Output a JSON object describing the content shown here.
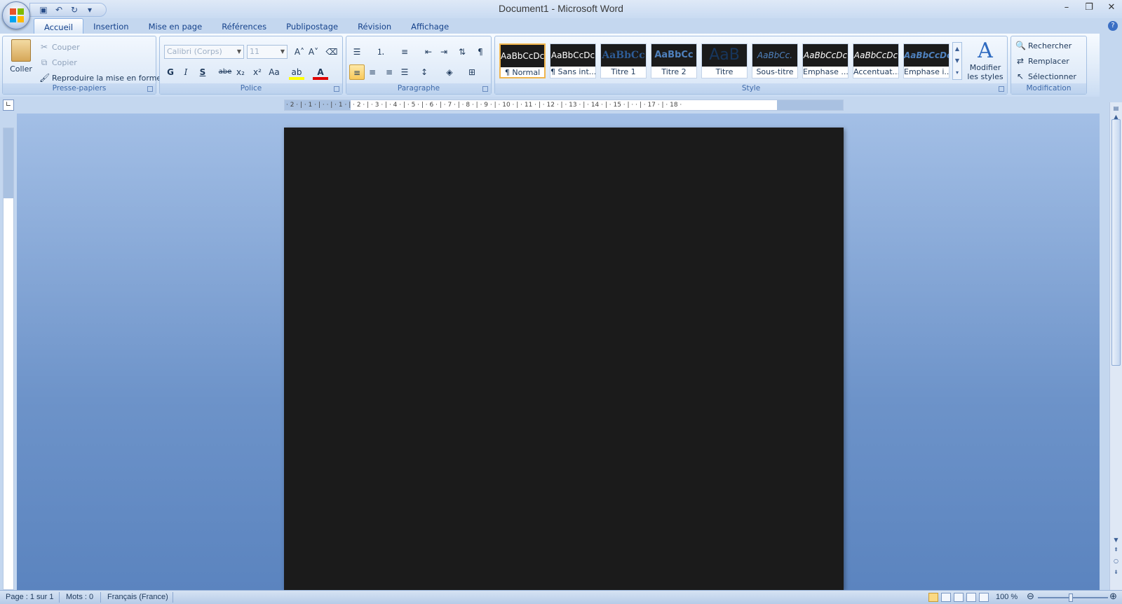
{
  "window": {
    "title": "Document1 - Microsoft Word"
  },
  "qat": {
    "save": "save-icon",
    "undo": "undo-icon",
    "redo": "redo-icon",
    "customize": "▾"
  },
  "tabs": [
    {
      "label": "Accueil"
    },
    {
      "label": "Insertion"
    },
    {
      "label": "Mise en page"
    },
    {
      "label": "Références"
    },
    {
      "label": "Publipostage"
    },
    {
      "label": "Révision"
    },
    {
      "label": "Affichage"
    }
  ],
  "clipboard": {
    "paste": "Coller",
    "cut": "Couper",
    "copy": "Copier",
    "format_painter": "Reproduire la mise en forme",
    "label": "Presse-papiers"
  },
  "font": {
    "name": "Calibri (Corps)",
    "size": "11",
    "label": "Police",
    "bold": "G",
    "italic": "I",
    "underline": "S",
    "strike": "abe",
    "subscript": "x₂",
    "superscript": "x²",
    "case": "Aa",
    "grow": "A˄",
    "shrink": "A˅"
  },
  "paragraph": {
    "label": "Paragraphe",
    "pilcrow": "¶"
  },
  "styles": {
    "label": "Style",
    "items": [
      {
        "preview": "AaBbCcDc",
        "name": "¶ Normal"
      },
      {
        "preview": "AaBbCcDc",
        "name": "¶ Sans int..."
      },
      {
        "preview": "AaBbCc",
        "name": "Titre 1"
      },
      {
        "preview": "AaBbCc",
        "name": "Titre 2"
      },
      {
        "preview": "AaB",
        "name": "Titre"
      },
      {
        "preview": "AaBbCc.",
        "name": "Sous-titre"
      },
      {
        "preview": "AaBbCcDc",
        "name": "Emphase ..."
      },
      {
        "preview": "AaBbCcDc",
        "name": "Accentuat..."
      },
      {
        "preview": "AaBbCcDc",
        "name": "Emphase i..."
      }
    ],
    "modify_line1": "Modifier",
    "modify_line2": "les styles"
  },
  "editing": {
    "label": "Modification",
    "find": "Rechercher",
    "replace": "Remplacer",
    "select": "Sélectionner"
  },
  "ruler": {
    "h_ticks": "· 2 · | · 1 · | ·  · | · 1 · | · 2 · | · 3 · | · 4 · | · 5 · | · 6 · | · 7 · | · 8 · | · 9 · | · 10 · | · 11 · | · 12 · | · 13 · | · 14 · | · 15 · | ·  · | · 17 · | · 18 ·"
  },
  "status": {
    "page": "Page : 1 sur 1",
    "words": "Mots : 0",
    "language": "Français (France)",
    "zoom": "100 %"
  },
  "colors": {
    "accent": "#15428b",
    "page_bg": "#1b1b1b",
    "selected_style": "#f0b54d"
  }
}
